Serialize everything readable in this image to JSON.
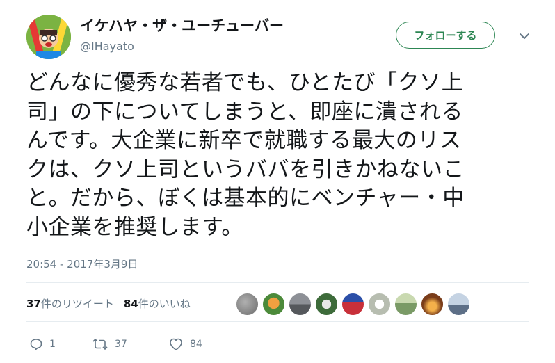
{
  "user": {
    "display_name": "イケハヤ・ザ・ユーチューバー",
    "handle": "@IHayato",
    "avatar_icon": "avatar-illustration"
  },
  "follow_button": {
    "label": "フォローする",
    "color": "#2d8653"
  },
  "menu_icon": "chevron-down-icon",
  "tweet": {
    "lines": [
      "どんなに優秀な若者でも、ひとたび「クソ上",
      "司」の下についてしまうと、即座に潰される",
      "んです。大企業に新卒で就職する最大のリス",
      "クは、クソ上司というババを引きかねないこ",
      "と。だから、ぼくは基本的にベンチャー・中",
      "小企業を推奨します。"
    ],
    "timestamp": "20:54 - 2017年3月9日"
  },
  "stats": {
    "retweets_count": "37",
    "retweets_label": "件のリツイート",
    "likes_count": "84",
    "likes_label": "件のいいね"
  },
  "liker_avatars": [
    {
      "name": "liker-avatar-1",
      "color": "#8a8a8a"
    },
    {
      "name": "liker-avatar-2",
      "color": "#d9823b"
    },
    {
      "name": "liker-avatar-3",
      "color": "#6b6e73"
    },
    {
      "name": "liker-avatar-4",
      "color": "#3d6b3a"
    },
    {
      "name": "liker-avatar-5",
      "color": "#c8303a"
    },
    {
      "name": "liker-avatar-6",
      "color": "#c9cfc4"
    },
    {
      "name": "liker-avatar-7",
      "color": "#7a9a66"
    },
    {
      "name": "liker-avatar-8",
      "color": "#b86a2a"
    },
    {
      "name": "liker-avatar-9",
      "color": "#7c8ca3"
    }
  ],
  "actions": {
    "reply_count": "1",
    "retweet_count": "37",
    "like_count": "84",
    "reply_icon": "reply-icon",
    "retweet_icon": "retweet-icon",
    "like_icon": "heart-icon"
  }
}
